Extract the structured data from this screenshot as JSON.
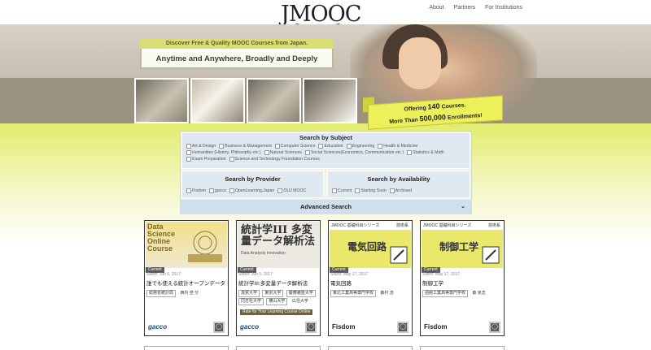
{
  "header": {
    "logo_text": "JMOOC",
    "nav": [
      "About",
      "Partners",
      "For Institutions"
    ]
  },
  "hero": {
    "tagline_small": "Discover Free & Quality MOOC Courses from Japan.",
    "tagline_main": "Anytime and Anywhere, Broadly and Deeply",
    "banner_line1_prefix": "Offering ",
    "banner_line1_num": "140",
    "banner_line1_suffix": " Courses.",
    "banner_line2_prefix": "More Than ",
    "banner_line2_num": "500,000",
    "banner_line2_suffix": " Enrollments!"
  },
  "search": {
    "subject_title": "Search by Subject",
    "subjects": [
      "Art & Design",
      "Business & Management",
      "Computer Science",
      "Education",
      "Engineering",
      "Health & Medicine",
      "Humanities (History, Philosophy etc.)",
      "Natural Sciences",
      "Social Sciences(Economics, Communication etc.)",
      "Statistics & Math",
      "Exam Preparation",
      "Science and Technology Foundation Courses"
    ],
    "provider_title": "Search by Provider",
    "providers": [
      "Fisdom",
      "gacco",
      "OpenLearning,Japan",
      "OUJ MOOC"
    ],
    "availability_title": "Search by Availability",
    "availability": [
      "Current",
      "Starting Soon",
      "Archived"
    ],
    "advanced_label": "Advanced Search"
  },
  "courses": [
    {
      "cover_text": "Data Science Online Course",
      "status": "Current",
      "starts": "Starts: Jun 6, 2017",
      "title": "誰でも使える統計オープンデータ",
      "institutions": [
        "総務省統計局",
        "西内 啓 分"
      ],
      "provider": "gacco"
    },
    {
      "cover_text": "統計学III 多変量データ解析法",
      "cover_sub": "Data Analysis Innovation",
      "status": "Current",
      "starts": "Starts: Jun 5, 2017",
      "title": "統計学III:多変量データ解析法",
      "institutions": [
        "滋賀大学",
        "東京大学",
        "慶應義塾大学",
        "同志社大学",
        "横山大学",
        "広島大学"
      ],
      "link": "Rate for Your Learning Course Online",
      "provider": "gacco"
    },
    {
      "series": "JMOOC 基礎科目シリーズ",
      "series_tag": "技術系",
      "cover_text": "電気回路",
      "status": "Current",
      "starts": "Starts: May 17, 2017",
      "title": "電気回路",
      "institutions": [
        "東北工業高等専門学校",
        "森村 浩"
      ],
      "provider": "Fisdom"
    },
    {
      "series": "JMOOC 基礎科目シリーズ",
      "series_tag": "技術系",
      "cover_text": "制御工学",
      "status": "Current",
      "starts": "Starts: May 17, 2017",
      "title": "制御工学",
      "institutions": [
        "函館工業高等専門学校",
        "森 克志"
      ],
      "provider": "Fisdom"
    }
  ]
}
